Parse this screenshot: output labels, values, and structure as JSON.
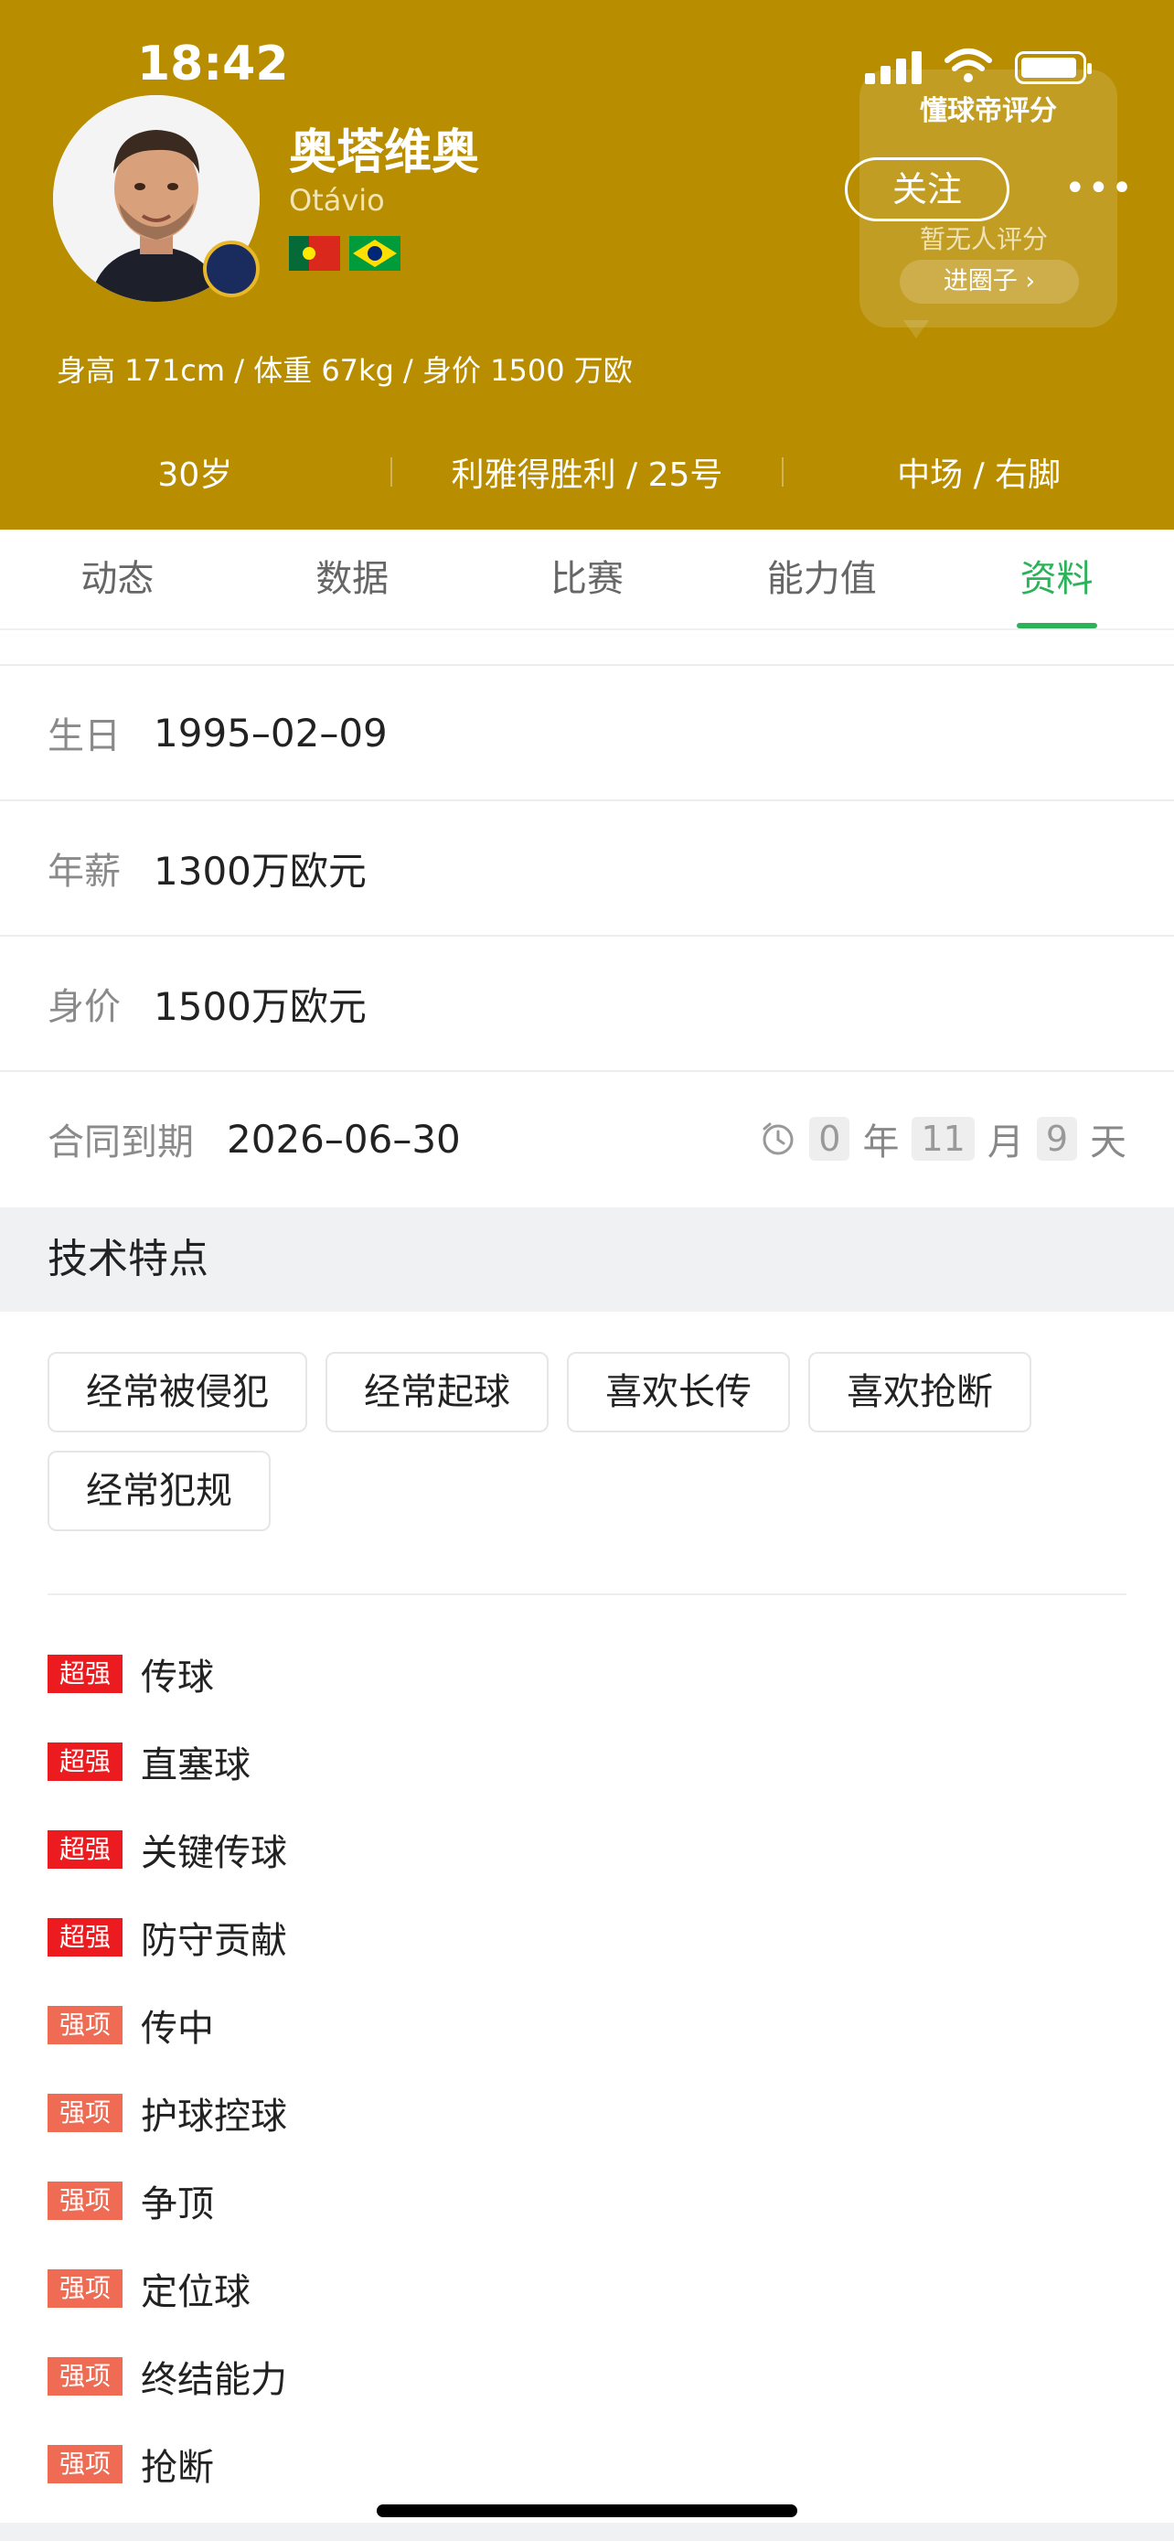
{
  "status_bar": {
    "time": "18:42"
  },
  "player": {
    "name": "奥塔维奥",
    "latin_name": "Otávio",
    "bio": "身高 171cm / 体重 67kg / 身价 1500 万欧",
    "flags": [
      "portugal-flag",
      "brazil-flag"
    ]
  },
  "rating_card": {
    "title": "懂球帝评分",
    "none": "暂无人评分",
    "circle_button": "进圈子 ›"
  },
  "actions": {
    "follow": "关注",
    "more": "•••"
  },
  "meta": {
    "age": "30岁",
    "club": "利雅得胜利 / 25号",
    "position": "中场 / 右脚"
  },
  "tabs": [
    {
      "label": "动态",
      "active": false
    },
    {
      "label": "数据",
      "active": false
    },
    {
      "label": "比赛",
      "active": false
    },
    {
      "label": "能力值",
      "active": false
    },
    {
      "label": "资料",
      "active": true
    }
  ],
  "info": {
    "birthday": {
      "label": "生日",
      "value": "1995–02–09"
    },
    "salary": {
      "label": "年薪",
      "value": "1300万欧元"
    },
    "market_value": {
      "label": "身价",
      "value": "1500万欧元"
    },
    "contract": {
      "label": "合同到期",
      "value": "2026–06–30",
      "years": "0",
      "years_unit": "年",
      "months": "11",
      "months_unit": "月",
      "days": "9",
      "days_unit": "天"
    }
  },
  "tech_section": {
    "title": "技术特点",
    "tags": [
      "经常被侵犯",
      "经常起球",
      "喜欢长传",
      "喜欢抢断",
      "经常犯规"
    ]
  },
  "features": [
    {
      "level": "超强",
      "type": "super",
      "text": "传球"
    },
    {
      "level": "超强",
      "type": "super",
      "text": "直塞球"
    },
    {
      "level": "超强",
      "type": "super",
      "text": "关键传球"
    },
    {
      "level": "超强",
      "type": "super",
      "text": "防守贡献"
    },
    {
      "level": "强项",
      "type": "strong",
      "text": "传中"
    },
    {
      "level": "强项",
      "type": "strong",
      "text": "护球控球"
    },
    {
      "level": "强项",
      "type": "strong",
      "text": "争顶"
    },
    {
      "level": "强项",
      "type": "strong",
      "text": "定位球"
    },
    {
      "level": "强项",
      "type": "strong",
      "text": "终结能力"
    },
    {
      "level": "强项",
      "type": "strong",
      "text": "抢断"
    }
  ],
  "colors": {
    "header": "#b88d00",
    "accent": "#2cb35a",
    "super_badge": "#ec1b1f",
    "strong_badge": "#f06b54"
  }
}
